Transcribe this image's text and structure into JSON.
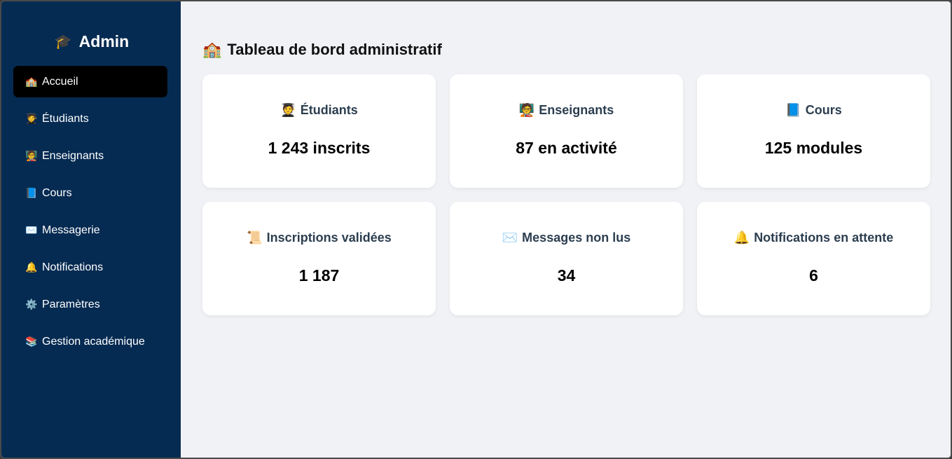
{
  "sidebar": {
    "brand_icon": "graduation-cap-icon",
    "brand_glyph": "🎓",
    "brand_label": "Admin",
    "items": [
      {
        "icon": "school-icon",
        "glyph": "🏫",
        "label": "Accueil",
        "active": true
      },
      {
        "icon": "student-icon",
        "glyph": "🧑‍🎓",
        "label": "Étudiants"
      },
      {
        "icon": "teacher-icon",
        "glyph": "🧑‍🏫",
        "label": "Enseignants"
      },
      {
        "icon": "book-icon",
        "glyph": "📘",
        "label": "Cours"
      },
      {
        "icon": "envelope-icon",
        "glyph": "✉️",
        "label": "Messagerie"
      },
      {
        "icon": "bell-icon",
        "glyph": "🔔",
        "label": "Notifications"
      },
      {
        "icon": "gear-icon",
        "glyph": "⚙️",
        "label": "Paramètres"
      },
      {
        "icon": "books-icon",
        "glyph": "📚",
        "label": "Gestion académique"
      }
    ]
  },
  "main": {
    "title_icon": "school-icon",
    "title_glyph": "🏫",
    "title": "Tableau de bord administratif",
    "cards": [
      {
        "icon": "student-icon",
        "glyph": "🧑‍🎓",
        "title": "Étudiants",
        "value": "1 243 inscrits"
      },
      {
        "icon": "teacher-icon",
        "glyph": "🧑‍🏫",
        "title": "Enseignants",
        "value": "87 en activité"
      },
      {
        "icon": "book-icon",
        "glyph": "📘",
        "title": "Cours",
        "value": "125 modules"
      },
      {
        "icon": "scroll-icon",
        "glyph": "📜",
        "title": "Inscriptions validées",
        "value": "1 187"
      },
      {
        "icon": "envelope-icon",
        "glyph": "✉️",
        "title": "Messages non lus",
        "value": "34"
      },
      {
        "icon": "bell-icon",
        "glyph": "🔔",
        "title": "Notifications en attente",
        "value": "6"
      }
    ]
  },
  "colors": {
    "sidebar_bg": "#062b52",
    "active_item_bg": "#000000",
    "main_bg": "#f0f2f5",
    "card_bg": "#ffffff",
    "card_title": "#2c3e50"
  }
}
